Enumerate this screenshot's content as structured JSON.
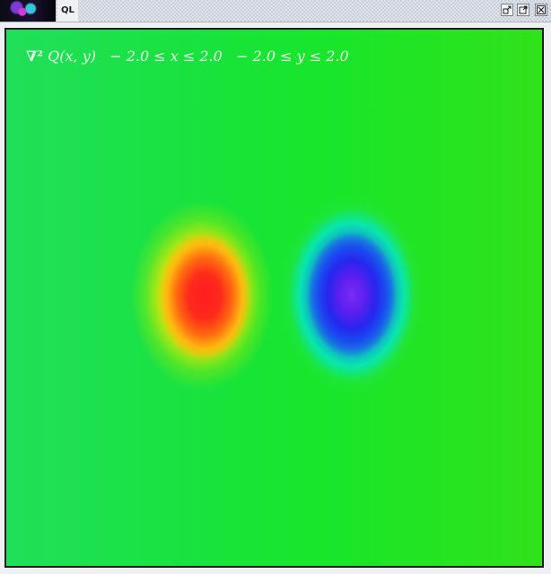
{
  "window": {
    "title": "QL",
    "controls": {
      "restore_icon": "restore-icon",
      "maximize_icon": "maximize-icon",
      "close_icon": "close-icon"
    }
  },
  "plot": {
    "operator": "∇²",
    "function": " Q(x, y)",
    "x_range": "   − 2.0 ≤ x ≤ 2.0",
    "y_range": "   − 2.0 ≤ y ≤ 2.0",
    "colormap_colors": {
      "background": "#18e33a",
      "positive_peak": "#ff1c20",
      "negative_peak": "#5a1ff0",
      "ring_cyan": "#00e6e6",
      "ring_yellow": "#f5e600"
    }
  }
}
